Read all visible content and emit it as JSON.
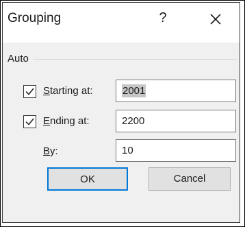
{
  "dialog": {
    "title": "Grouping",
    "help_label": "?",
    "close_icon": "close-x-icon"
  },
  "group": {
    "label": "Auto"
  },
  "starting": {
    "checked": true,
    "label_accel": "S",
    "label_rest": "tarting at:",
    "value": "2001"
  },
  "ending": {
    "checked": true,
    "label_accel": "E",
    "label_rest": "nding at:",
    "value": "2200"
  },
  "by": {
    "label_accel": "B",
    "label_rest": "y:",
    "value": "10"
  },
  "buttons": {
    "ok_label": "OK",
    "cancel_label": "Cancel"
  },
  "colors": {
    "focus_border": "#0078d7",
    "client_bg": "#f0f0f0",
    "button_bg": "#e1e1e1"
  }
}
